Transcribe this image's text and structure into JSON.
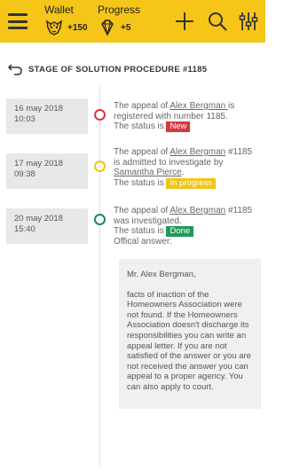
{
  "header": {
    "wallet": {
      "label": "Wallet",
      "value": "+150",
      "icon": "tiger-head-icon"
    },
    "progress": {
      "label": "Progress",
      "value": "+5",
      "icon": "diamond-icon"
    },
    "actions": [
      "menu-icon",
      "plus-icon",
      "search-icon",
      "filter-sliders-icon"
    ],
    "accent": "#f5c518"
  },
  "page": {
    "title": "STAGE OF SOLUTION PROCEDURE #1185"
  },
  "timeline": [
    {
      "date": "16 may 2018",
      "time": "10:03",
      "status_color": "#d9363e",
      "text_a": "The appeal of ",
      "person": "Alex Bergman ",
      "text_b": "is registered with number 1185.",
      "status_prefix": "The status is ",
      "status": "New"
    },
    {
      "date": "17 may 2018",
      "time": "09:38",
      "status_color": "#f0c419",
      "text_a": "The appeal of ",
      "person": "Alex Bergman",
      "text_b": " #1185 is admitted to investigate by ",
      "assignee": "Samantha Pierce",
      "text_c": ".",
      "status_prefix": "The status is ",
      "status": "In progress"
    },
    {
      "date": "20 may 2018",
      "time": "15:40",
      "status_color": "#1e9a5a",
      "text_a": "The appeal of ",
      "person": "Alex Bergman",
      "text_b": " #1185 was investigated.",
      "status_prefix": "The status is ",
      "status": "Done",
      "answer_label": "Offical answer:"
    }
  ],
  "answer": {
    "greeting": "Mr. Alex Bergman,",
    "body": "facts of inaction of the Homeowners Association were not found. If the Homeowners Association doesn't discharge its responsibilities you can write an appeal letter. If you are not satisfied of the answer or you are not received the answer you can appeal to a proper agency. You can also apply to court."
  }
}
